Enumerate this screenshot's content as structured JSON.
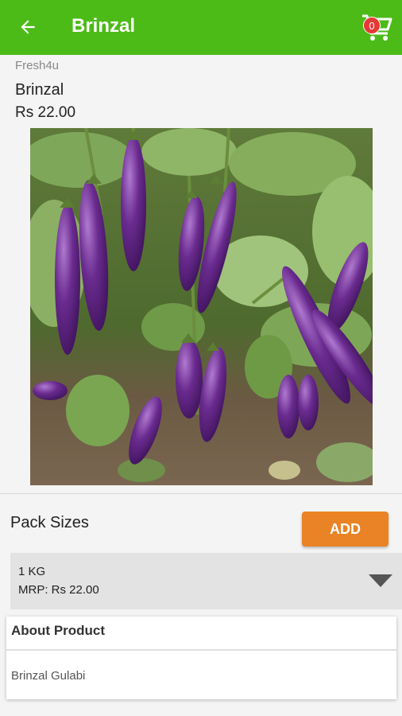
{
  "appbar": {
    "title": "Brinzal",
    "cart_count": "0",
    "color": "#4cbb17"
  },
  "product": {
    "store": "Fresh4u",
    "name": "Brinzal",
    "price": "Rs 22.00",
    "image_icon": "brinjal-plant-photo"
  },
  "pack": {
    "label": "Pack Sizes",
    "add_label": "ADD",
    "selected_size": "1 KG",
    "selected_mrp": "MRP: Rs 22.00",
    "add_color": "#e98325"
  },
  "about": {
    "title": "About Product",
    "description": "Brinzal Gulabi"
  }
}
